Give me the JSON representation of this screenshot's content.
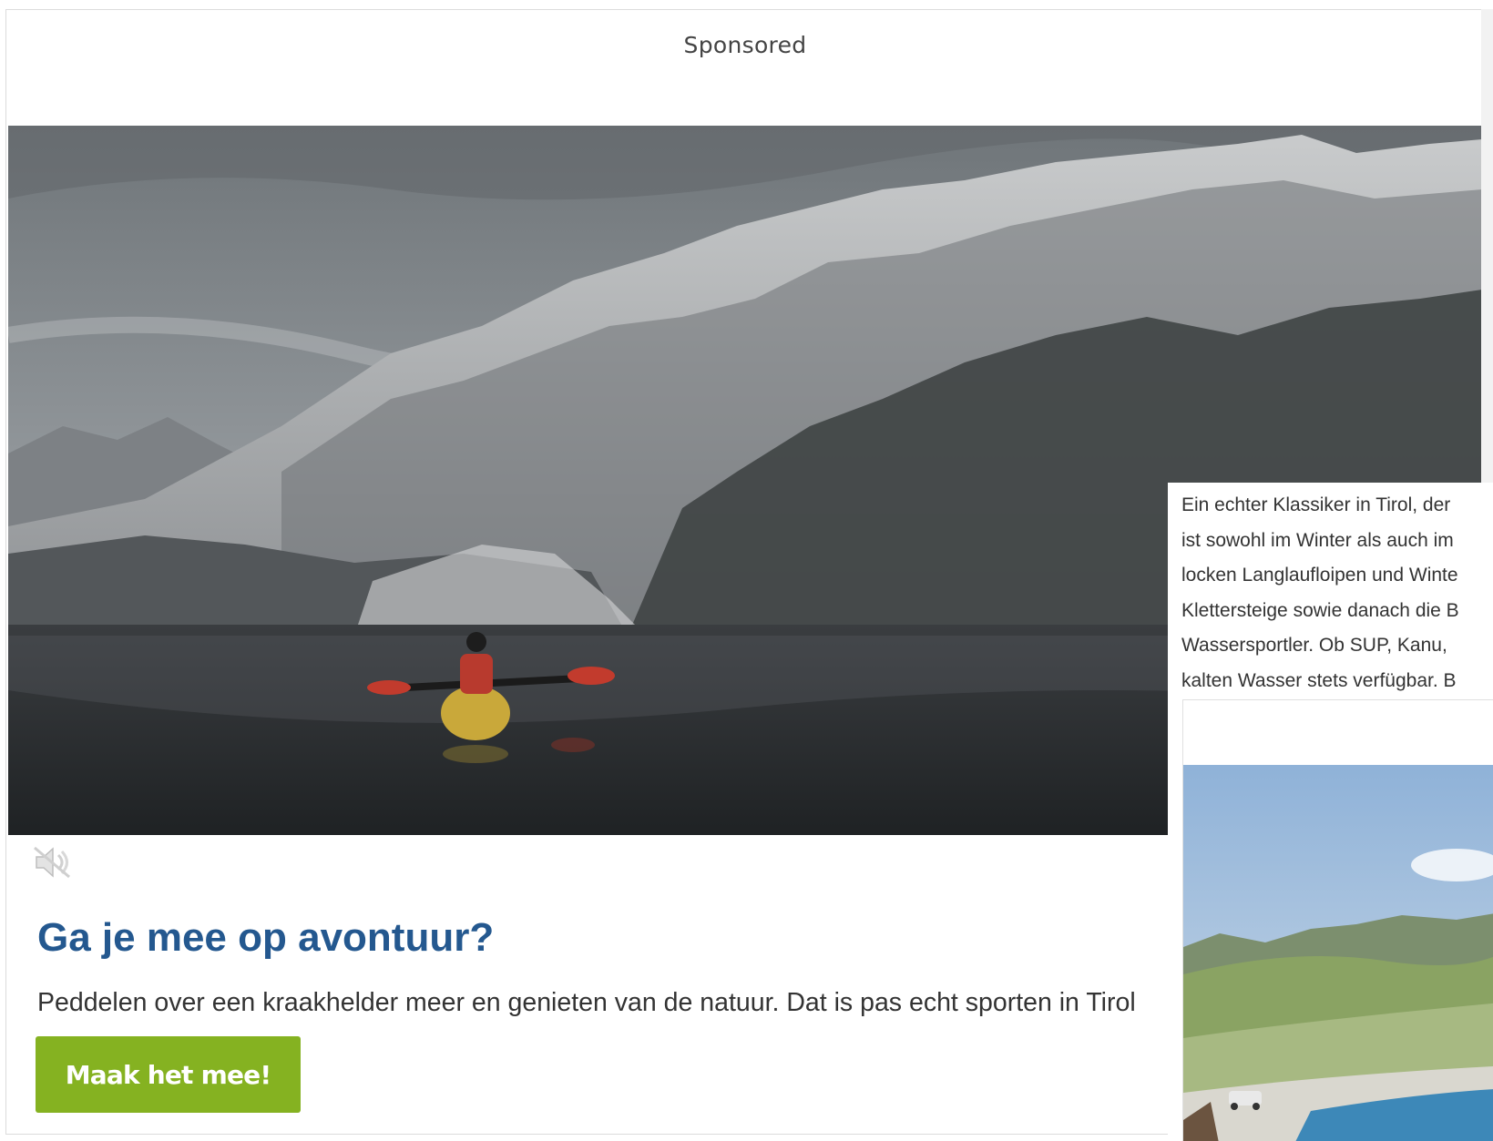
{
  "ad": {
    "sponsored_label": "Sponsored",
    "headline": "Ga je mee op avontuur?",
    "body": "Peddelen over een kraakhelder meer en genieten van de natuur. Dat is pas echt sporten in Tirol",
    "cta_label": "Maak het mee!",
    "hero_image": "kayaker on a mountain lake with snowy peaks",
    "mute_icon": "muted-speaker-icon",
    "colors": {
      "headline": "#24588f",
      "cta_background": "#85b221",
      "cta_text": "#ffffff"
    }
  },
  "article": {
    "lines": [
      "Ein echter Klassiker in Tirol, der",
      "ist sowohl im Winter als auch im",
      "locken Langlaufloipen und Winte",
      "Klettersteige sowie danach die B",
      "Wassersportler. Ob SUP, Kanu,",
      "kalten Wasser stets verfügbar. B"
    ],
    "image": "green alpine valley with a mountain lake and parked car"
  }
}
